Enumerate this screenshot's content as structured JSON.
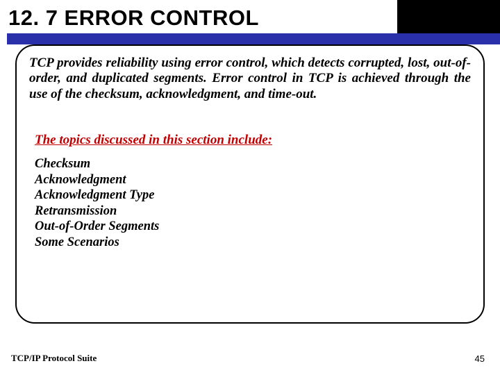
{
  "title": "12. 7   ERROR CONTROL",
  "intro": "TCP provides reliability using error control, which detects corrupted, lost, out-of-order, and duplicated segments. Error control in TCP is achieved through the use of the checksum, acknowledgment, and time-out.",
  "topicsHeading": "The topics discussed in this section include:",
  "topics": [
    "Checksum",
    "Acknowledgment",
    "Acknowledgment Type",
    "Retransmission",
    "Out-of-Order Segments",
    "Some Scenarios"
  ],
  "footerLeft": "TCP/IP Protocol Suite",
  "pageNumber": "45"
}
